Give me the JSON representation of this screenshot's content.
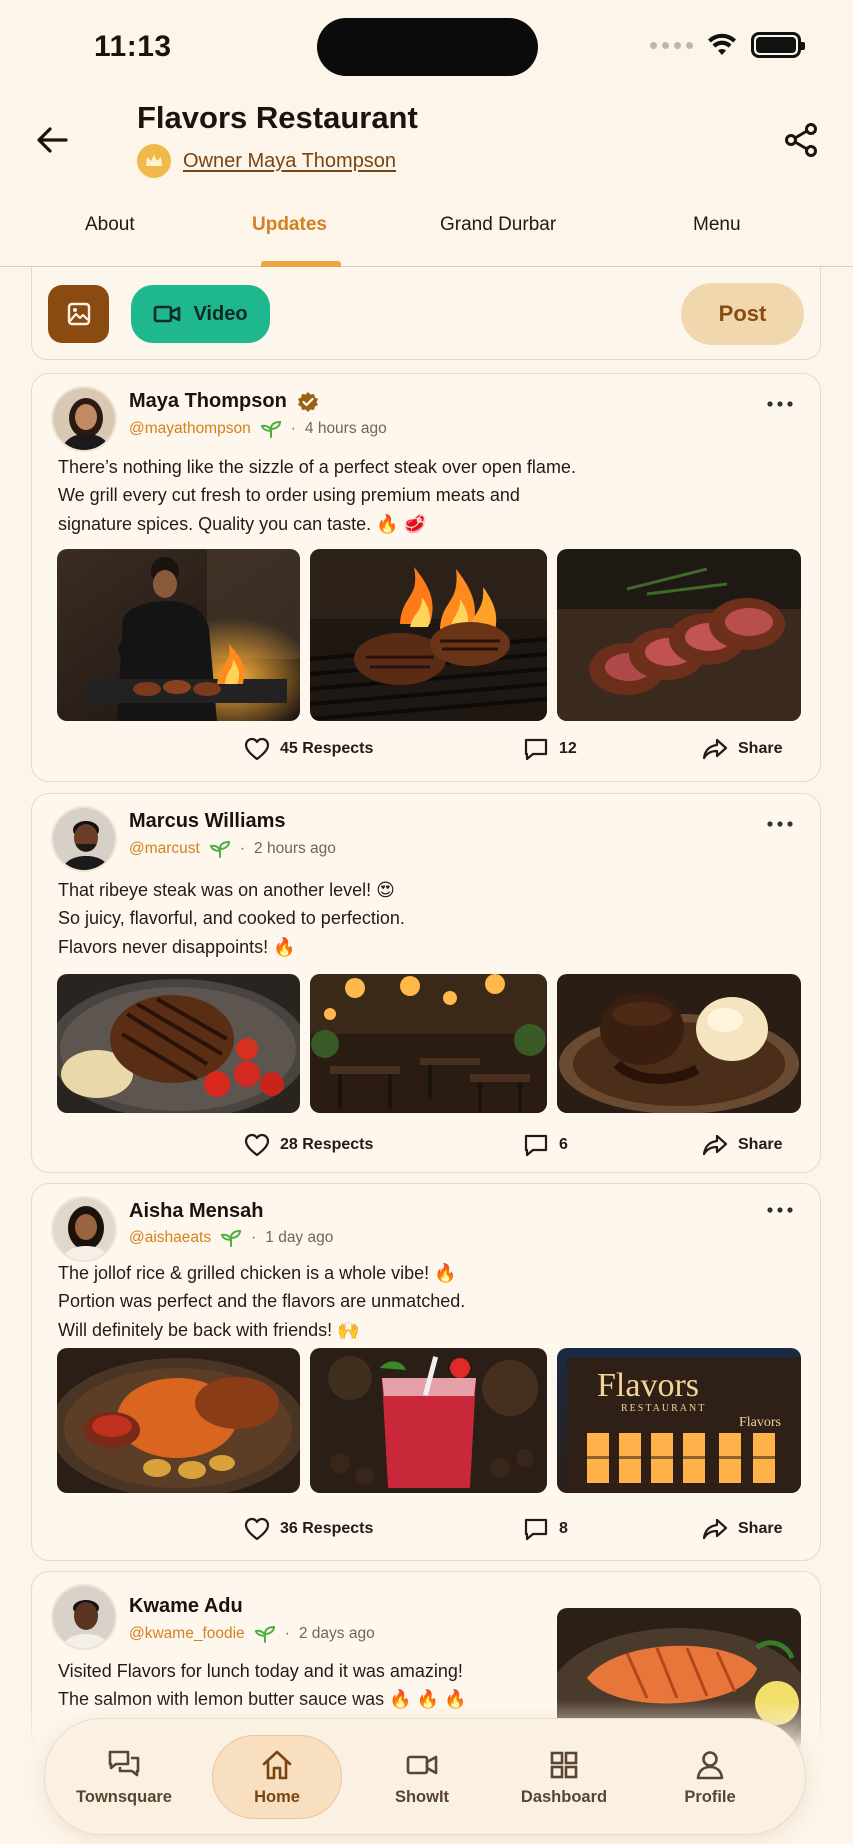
{
  "status": {
    "time": "11:13"
  },
  "header": {
    "title": "Flavors Restaurant",
    "owner_label": "Owner Maya Thompson"
  },
  "tabs": [
    {
      "label": "About",
      "active": false
    },
    {
      "label": "Updates",
      "active": true
    },
    {
      "label": "Grand Durbar",
      "active": false
    },
    {
      "label": "Menu",
      "active": false
    }
  ],
  "composer": {
    "video_label": "Video",
    "post_label": "Post"
  },
  "posts": [
    {
      "name": "Maya Thompson",
      "verified": true,
      "handle": "@mayathompson",
      "time": "4 hours ago",
      "lines": [
        "There’s nothing like the sizzle of a perfect steak over open flame.",
        "We grill every cut fresh to order using premium meats and",
        "signature spices. Quality you can taste. 🔥 🥩"
      ],
      "respects": "45 Respects",
      "comments": "12",
      "share": "Share"
    },
    {
      "name": "Marcus Williams",
      "verified": false,
      "handle": "@marcust",
      "time": "2 hours ago",
      "lines": [
        "That ribeye steak was on another level! 😍",
        "So juicy, flavorful, and cooked to perfection.",
        "Flavors never disappoints! 🔥"
      ],
      "respects": "28 Respects",
      "comments": "6",
      "share": "Share"
    },
    {
      "name": "Aisha Mensah",
      "verified": false,
      "handle": "@aishaeats",
      "time": "1 day ago",
      "lines": [
        "The jollof rice & grilled chicken is a whole vibe! 🔥",
        "Portion was perfect and the flavors are unmatched.",
        "Will definitely be back with friends! 🙌"
      ],
      "respects": "36 Respects",
      "comments": "8",
      "share": "Share"
    },
    {
      "name": "Kwame Adu",
      "verified": false,
      "handle": "@kwame_foodie",
      "time": "2 days ago",
      "lines": [
        "Visited Flavors for lunch today and it was amazing!",
        "The salmon with lemon butter sauce was 🔥 🔥 🔥"
      ]
    }
  ],
  "storefront_sign": {
    "brand": "Flavors",
    "sub": "RESTAURANT"
  },
  "nav": [
    {
      "label": "Townsquare",
      "icon": "chat-bubbles-icon",
      "active": false
    },
    {
      "label": "Home",
      "icon": "home-icon",
      "active": true
    },
    {
      "label": "ShowIt",
      "icon": "video-camera-icon",
      "active": false
    },
    {
      "label": "Dashboard",
      "icon": "grid-icon",
      "active": false
    },
    {
      "label": "Profile",
      "icon": "person-icon",
      "active": false
    }
  ],
  "colors": {
    "accent": "#d6801d",
    "brown": "#8a4b10",
    "green": "#1fb78e",
    "background": "#fdf5ea"
  }
}
